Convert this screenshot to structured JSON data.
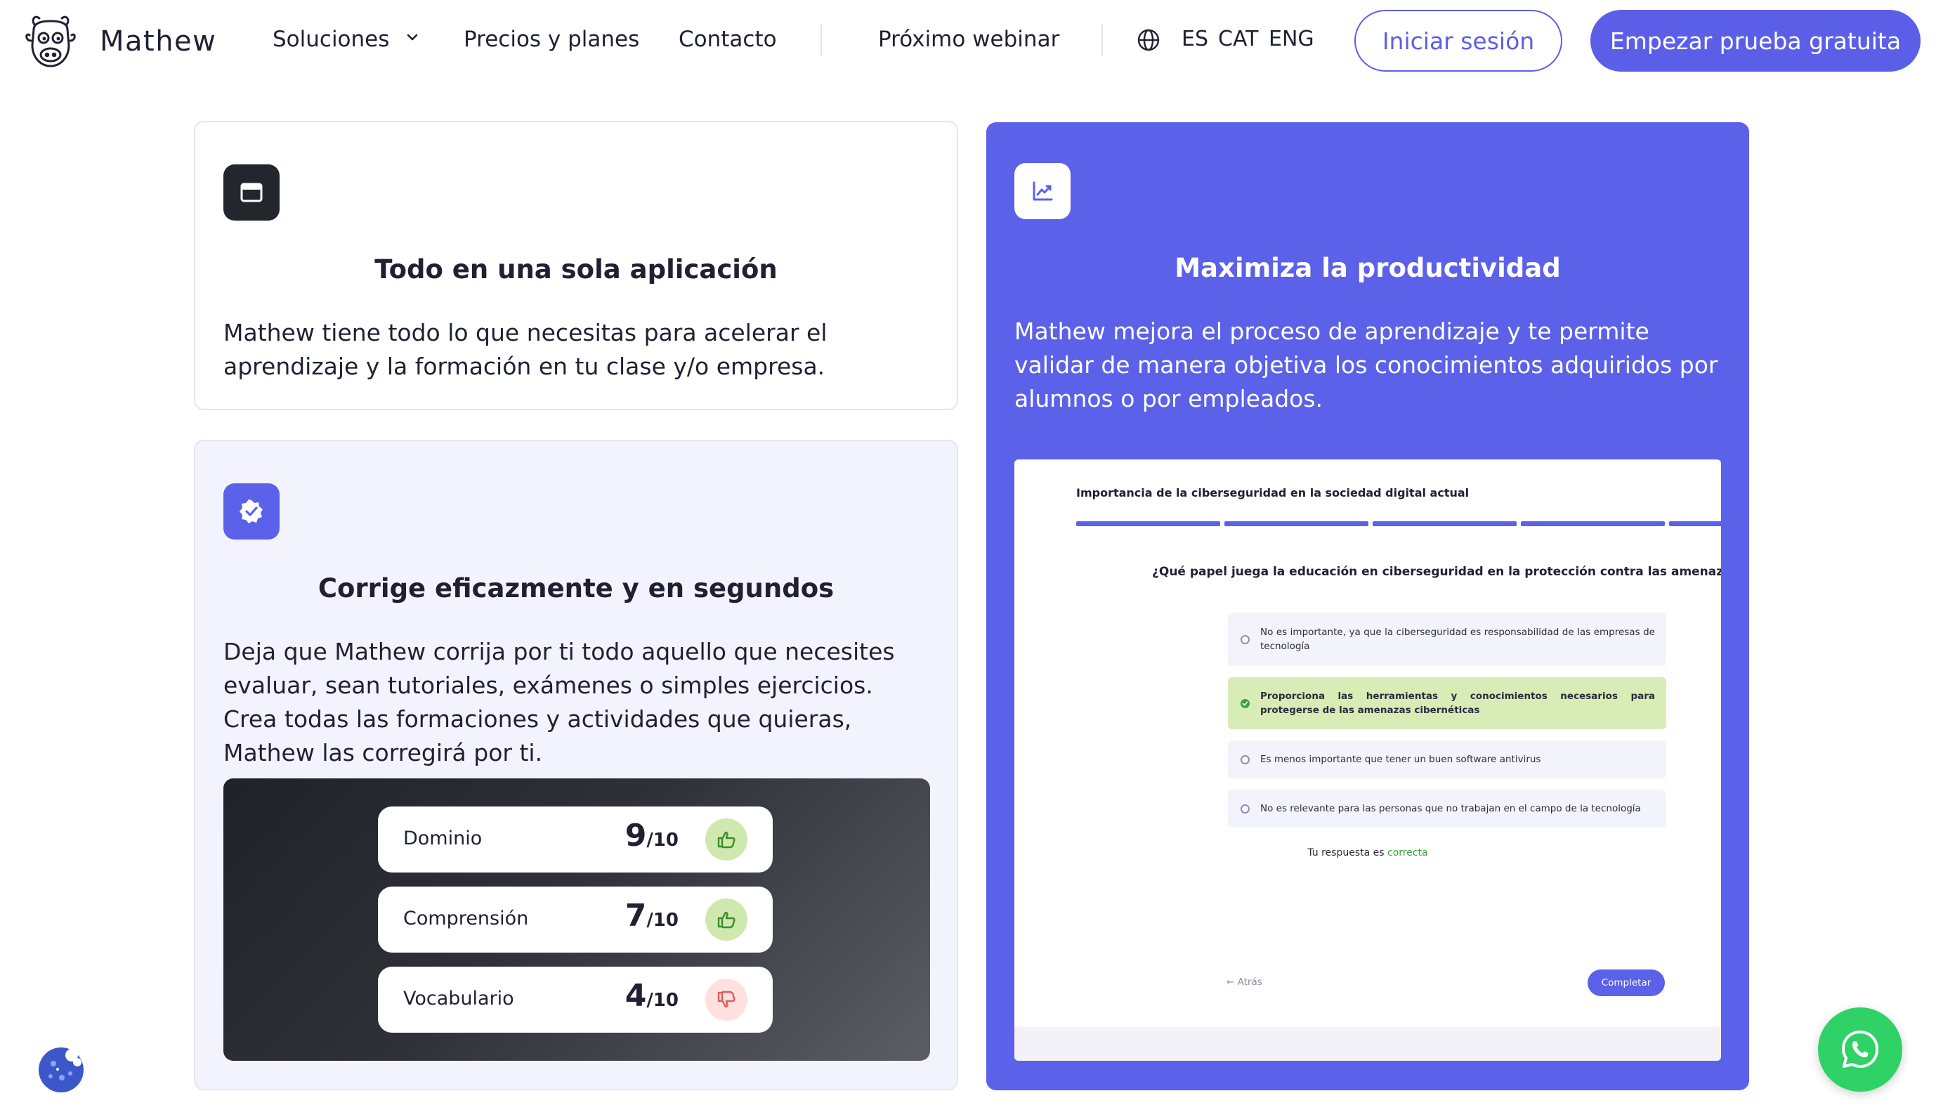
{
  "brand": {
    "name": "Mathew"
  },
  "nav": {
    "solutions": "Soluciones",
    "pricing": "Precios y planes",
    "contact": "Contacto",
    "webinar": "Próximo webinar",
    "languages": [
      "ES",
      "CAT",
      "ENG"
    ],
    "login": "Iniciar sesión",
    "trial": "Empezar prueba gratuita"
  },
  "cards": {
    "all_in_one": {
      "title": "Todo en una sola aplicación",
      "body": "Mathew tiene todo lo que necesitas para acelerar el aprendizaje y la formación en tu clase y/o empresa."
    },
    "correct": {
      "title": "Corrige eficazmente y en segundos",
      "body": "Deja que Mathew corrija por ti todo aquello que necesites evaluar, sean tutoriales, exámenes o simples ejercicios. Crea todas las formaciones y actividades que quieras, Mathew las corregirá por ti."
    },
    "productivity": {
      "title": "Maximiza la productividad",
      "body": "Mathew mejora el proceso de aprendizaje y te permite validar de manera objetiva los conocimientos adquiridos por alumnos o por empleados."
    }
  },
  "scores": [
    {
      "label": "Dominio",
      "score": "9",
      "denominator": "/10",
      "verdict": "up"
    },
    {
      "label": "Comprensión",
      "score": "7",
      "denominator": "/10",
      "verdict": "up"
    },
    {
      "label": "Vocabulario",
      "score": "4",
      "denominator": "/10",
      "verdict": "down"
    }
  ],
  "quiz": {
    "title": "Importancia de la ciberseguridad en la sociedad digital actual",
    "question": "¿Qué papel juega la educación en ciberseguridad en la protección contra las amenazas cibernéticas?",
    "options": [
      "No es importante, ya que la ciberseguridad es responsabilidad de las empresas de tecnología",
      "Proporciona las herramientas y conocimientos necesarios para protegerse de las amenazas cibernéticas",
      "Es menos importante que tener un buen software antivirus",
      "No es relevante para las personas que no trabajan en el campo de la tecnología"
    ],
    "correct_index": 1,
    "feedback_prefix": "Tu respuesta es",
    "feedback_result": "correcta",
    "back": "Atrás",
    "complete": "Completar"
  },
  "colors": {
    "accent": "#5b5fe8",
    "card_purple": "#5b61e8",
    "whatsapp": "#2fd266",
    "thumb_up_bg": "#cfe8b0",
    "thumb_down_bg": "#fde1e1",
    "correct_bg": "#d8ecb6"
  },
  "icons": {
    "app": "browser-window-icon",
    "productivity": "chart-up-icon",
    "correct": "verified-badge-icon",
    "language": "globe-icon",
    "whatsapp": "whatsapp-icon",
    "cookie": "cookie-icon"
  }
}
